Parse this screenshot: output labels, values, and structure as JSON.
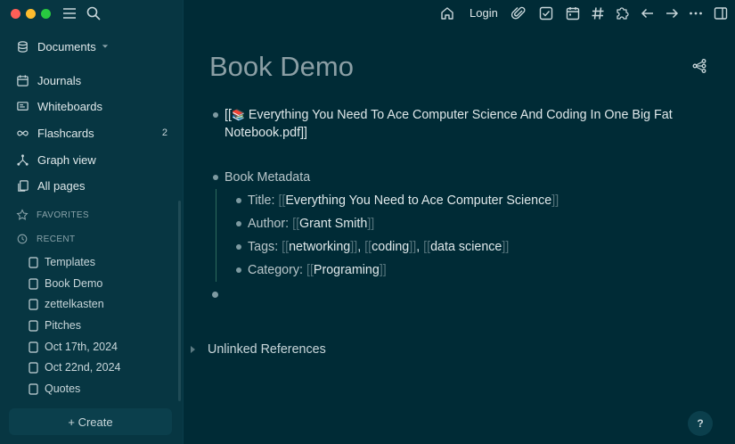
{
  "sidebar": {
    "documents_label": "Documents",
    "journals": "Journals",
    "whiteboards": "Whiteboards",
    "flashcards": "Flashcards",
    "flashcards_count": "2",
    "graph_view": "Graph view",
    "all_pages": "All pages",
    "favorites": "FAVORITES",
    "recent": "RECENT",
    "recent_items": [
      "Templates",
      "Book Demo",
      "zettelkasten",
      "Pitches",
      "Oct 17th, 2024",
      "Oct 22nd, 2024",
      "Quotes"
    ],
    "create_label": "+ Create"
  },
  "header": {
    "login": "Login"
  },
  "page": {
    "title": "Book Demo",
    "pdf_line1": "Everything You Need To Ace Computer Science And Coding In One Big Fat",
    "pdf_line2": "Notebook.pdf",
    "pdf_open": "[[",
    "pdf_close": "]]",
    "book_emoji": "📚",
    "metadata_label": "Book Metadata",
    "props": {
      "title_key": "Title:",
      "title_val": "Everything You Need to Ace Computer Science",
      "author_key": "Author:",
      "author_val": "Grant Smith",
      "tags_key": "Tags:",
      "tags": [
        "networking",
        "coding",
        "data science"
      ],
      "category_key": "Category:",
      "category_val": "Programing"
    },
    "unlinked": "Unlinked References",
    "help": "?"
  }
}
